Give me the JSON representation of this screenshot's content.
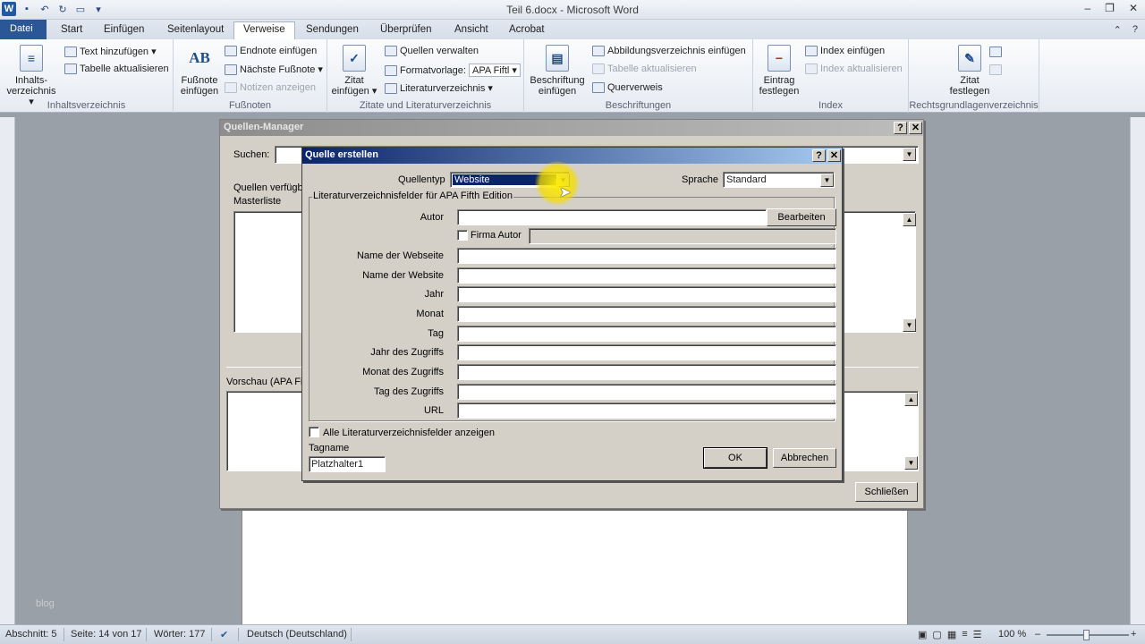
{
  "window": {
    "title": "Teil 6.docx - Microsoft Word",
    "minimize": "–",
    "maximize": "❐",
    "close": "✕",
    "qat_icons": [
      "word-icon",
      "save-icon",
      "undo-icon",
      "redo-icon",
      "open-icon",
      "customize-icon"
    ]
  },
  "tabs": [
    "Datei",
    "Start",
    "Einfügen",
    "Seitenlayout",
    "Verweise",
    "Sendungen",
    "Überprüfen",
    "Ansicht",
    "Acrobat"
  ],
  "active_tab": "Verweise",
  "ribbon": {
    "inhalt": {
      "big": "Inhalts-\nverzeichnis",
      "big1": "Inhalts-",
      "big2": "verzeichnis ▾",
      "text_add": "Text hinzufügen ▾",
      "update": "Tabelle aktualisieren",
      "label": "Inhaltsverzeichnis"
    },
    "fussnoten": {
      "big1": "Fußnote",
      "big2": "einfügen",
      "endnote": "Endnote einfügen",
      "next": "Nächste Fußnote ▾",
      "notes": "Notizen anzeigen",
      "label": "Fußnoten",
      "ab": "AB"
    },
    "zitate": {
      "big1": "Zitat",
      "big2": "einfügen ▾",
      "manage": "Quellen verwalten",
      "style_label": "Formatvorlage:",
      "style_value": "APA Fiftl ▾",
      "bib": "Literaturverzeichnis ▾",
      "label": "Zitate und Literaturverzeichnis"
    },
    "beschriftungen": {
      "big1": "Beschriftung",
      "big2": "einfügen",
      "fig_index": "Abbildungsverzeichnis einfügen",
      "upd": "Tabelle aktualisieren",
      "cross": "Querverweis",
      "label": "Beschriftungen"
    },
    "index": {
      "big1": "Eintrag",
      "big2": "festlegen",
      "insert": "Index einfügen",
      "upd": "Index aktualisieren",
      "label": "Index"
    },
    "recht": {
      "big1": "Zitat",
      "big2": "festlegen",
      "label": "Rechtsgrundlagenverzeichnis"
    }
  },
  "quellen_manager": {
    "title": "Quellen-Manager",
    "search_label": "Suchen:",
    "avail_label1": "Quellen verfügba",
    "avail_label2": "Masterliste",
    "preview_label": "Vorschau (APA Fift",
    "close_btn": "Schließen",
    "help": "?",
    "x": "✕"
  },
  "quelle_erstellen": {
    "title": "Quelle erstellen",
    "help": "?",
    "x": "✕",
    "source_type_label": "Quellentyp",
    "source_type_value": "Website",
    "language_label": "Sprache",
    "language_value": "Standard",
    "fieldset_legend": "Literaturverzeichnisfelder für APA Fifth Edition",
    "author_label": "Autor",
    "edit_btn": "Bearbeiten",
    "corp_author": "Firma Autor",
    "fields": [
      {
        "label": "Name der Webseite",
        "value": ""
      },
      {
        "label": "Name der Website",
        "value": ""
      },
      {
        "label": "Jahr",
        "value": ""
      },
      {
        "label": "Monat",
        "value": ""
      },
      {
        "label": "Tag",
        "value": ""
      },
      {
        "label": "Jahr des Zugriffs",
        "value": ""
      },
      {
        "label": "Monat des Zugriffs",
        "value": ""
      },
      {
        "label": "Tag des Zugriffs",
        "value": ""
      },
      {
        "label": "URL",
        "value": ""
      }
    ],
    "show_all": "Alle Literaturverzeichnisfelder anzeigen",
    "tag_label": "Tagname",
    "tag_value": "Platzhalter1",
    "ok": "OK",
    "cancel": "Abbrechen"
  },
  "status": {
    "section": "Abschnitt: 5",
    "page": "Seite: 14 von 17",
    "words": "Wörter: 177",
    "lang": "Deutsch (Deutschland)",
    "zoom": "100 %",
    "minus": "–",
    "plus": "+"
  },
  "watermark": "blog"
}
